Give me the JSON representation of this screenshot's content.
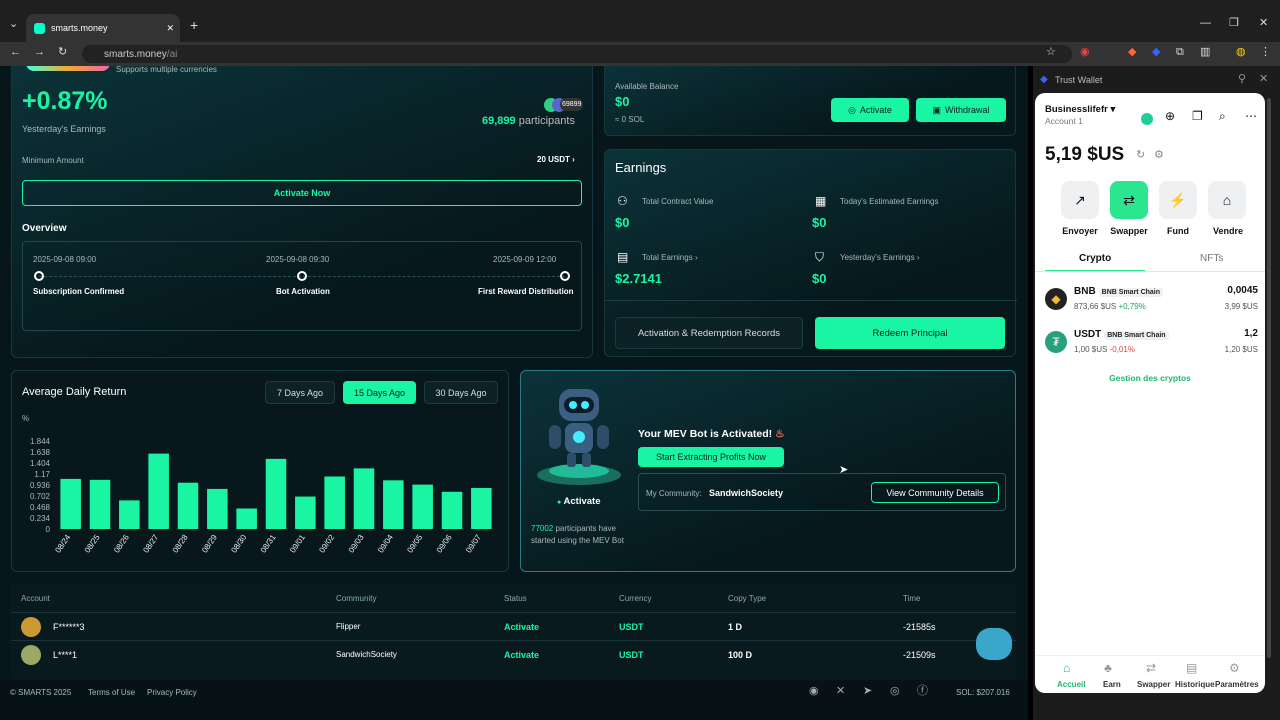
{
  "browser": {
    "tab_title": "smarts.money",
    "url_host": "smarts.money",
    "url_path": "/ai"
  },
  "top_card": {
    "subtitle": "Supports multiple currencies",
    "percent": "+0.87%",
    "percent_label": "Yesterday's Earnings",
    "avatar_count": "69899",
    "participants_num": "69,899",
    "participants_label": "participants",
    "min_label": "Minimum Amount",
    "min_value": "20 USDT",
    "activate_btn": "Activate Now",
    "overview_title": "Overview",
    "timeline": [
      {
        "date": "2025-09-08 09:00",
        "label": "Subscription Confirmed"
      },
      {
        "date": "2025-09-08 09:30",
        "label": "Bot Activation"
      },
      {
        "date": "2025-09-09 12:00",
        "label": "First Reward Distribution"
      }
    ]
  },
  "balance": {
    "label": "Available Balance",
    "value": "$0",
    "sol": "≈ 0 SOL",
    "activate_btn": "Activate",
    "withdraw_btn": "Withdrawal"
  },
  "earnings": {
    "title": "Earnings",
    "items": [
      {
        "label": "Total Contract Value",
        "value": "$0"
      },
      {
        "label": "Today's Estimated Earnings",
        "value": "$0"
      },
      {
        "label": "Total Earnings",
        "value": "$2.7141"
      },
      {
        "label": "Yesterday's Earnings",
        "value": "$0"
      }
    ],
    "records_btn": "Activation & Redemption Records",
    "redeem_btn": "Redeem Principal"
  },
  "chart_title": "Average Daily Return",
  "chart_tabs": [
    "7 Days Ago",
    "15 Days Ago",
    "30 Days Ago"
  ],
  "chart_data": {
    "type": "bar",
    "ylabel": "%",
    "yticks": [
      "1.844",
      "1.638",
      "1.404",
      "1.17",
      "0.936",
      "0.702",
      "0.468",
      "0.234",
      "0"
    ],
    "ylim": [
      0,
      1.844
    ],
    "categories": [
      "08/24",
      "08/25",
      "08/26",
      "08/27",
      "08/28",
      "08/29",
      "08/30",
      "08/31",
      "09/01",
      "09/02",
      "09/03",
      "09/04",
      "09/05",
      "09/06",
      "09/07"
    ],
    "values": [
      1.05,
      1.03,
      0.6,
      1.58,
      0.97,
      0.84,
      0.43,
      1.47,
      0.68,
      1.1,
      1.27,
      1.02,
      0.93,
      0.78,
      0.86
    ],
    "color": "#19f5a3"
  },
  "bot": {
    "status": "Activate",
    "count": "77002",
    "count_text": "participants have started using the MEV Bot",
    "title": "Your MEV Bot is Activated!",
    "extract_btn": "Start Extracting Profits Now",
    "community_label": "My Community:",
    "community_name": "SandwichSociety",
    "community_btn": "View Community Details"
  },
  "table": {
    "headers": [
      "Account",
      "Community",
      "Status",
      "Currency",
      "Copy Type",
      "Time"
    ],
    "rows": [
      [
        "F******3",
        "Flipper",
        "Activate",
        "USDT",
        "1 D",
        "-21585s"
      ],
      [
        "L****1",
        "SandwichSociety",
        "Activate",
        "USDT",
        "100 D",
        "-21509s"
      ]
    ]
  },
  "footer": {
    "copyright": "© SMARTS 2025",
    "terms": "Terms of Use",
    "privacy": "Privacy Policy",
    "sol": "SOL: $207.016"
  },
  "wallet": {
    "title": "Trust Wallet",
    "name": "Businesslifefr",
    "account": "Account 1",
    "balance": "5,19 $US",
    "actions": [
      "Envoyer",
      "Swapper",
      "Fund",
      "Vendre"
    ],
    "tabs": [
      "Crypto",
      "NFTs"
    ],
    "tokens": [
      {
        "sym": "BNB",
        "chain": "BNB Smart Chain",
        "price": "873,66 $US",
        "change": "+0,79%",
        "amount": "0,0045",
        "value": "3,99 $US"
      },
      {
        "sym": "USDT",
        "chain": "BNB Smart Chain",
        "price": "1,00 $US",
        "change": "-0,01%",
        "amount": "1,2",
        "value": "1,20 $US"
      }
    ],
    "manage": "Gestion des cryptos",
    "nav": [
      "Accueil",
      "Earn",
      "Swapper",
      "Historique",
      "Paramètres"
    ]
  }
}
